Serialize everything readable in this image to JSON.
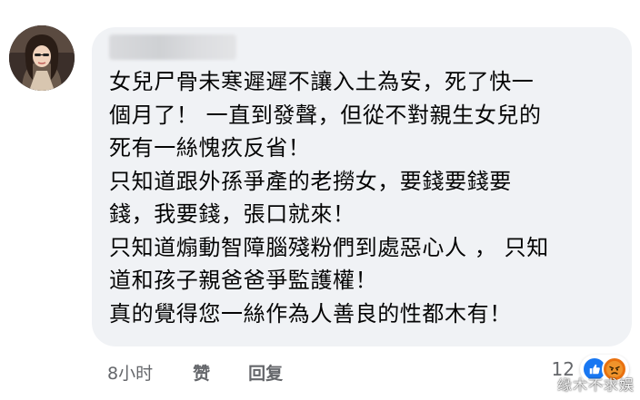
{
  "comment": {
    "author_name": "",
    "text_lines": [
      "女兒尸骨未寒遲遲不讓入土為安，死了快一",
      "個月了！ 一直到發聲，但從不對親生女兒的",
      "死有一絲愧疚反省！",
      "只知道跟外孫爭產的老撈女，要錢要錢要",
      "錢，我要錢，張口就來！",
      "只知道煽動智障腦殘粉們到處惡心人 ， 只知",
      "道和孩子親爸爸爭監護權！",
      "真的覺得您一絲作為人善良的性都木有！"
    ]
  },
  "actions": {
    "time": "8小时",
    "like_label": "赞",
    "reply_label": "回复"
  },
  "reactions": {
    "count": "12",
    "icons": [
      "like-icon",
      "angry-icon"
    ]
  },
  "watermark": "缘木不求娱",
  "colors": {
    "bubble_bg": "#f0f2f5",
    "text": "#050505",
    "meta_text": "#65676b",
    "like_blue": "#1877f2",
    "angry_orange": "#e9710f"
  }
}
